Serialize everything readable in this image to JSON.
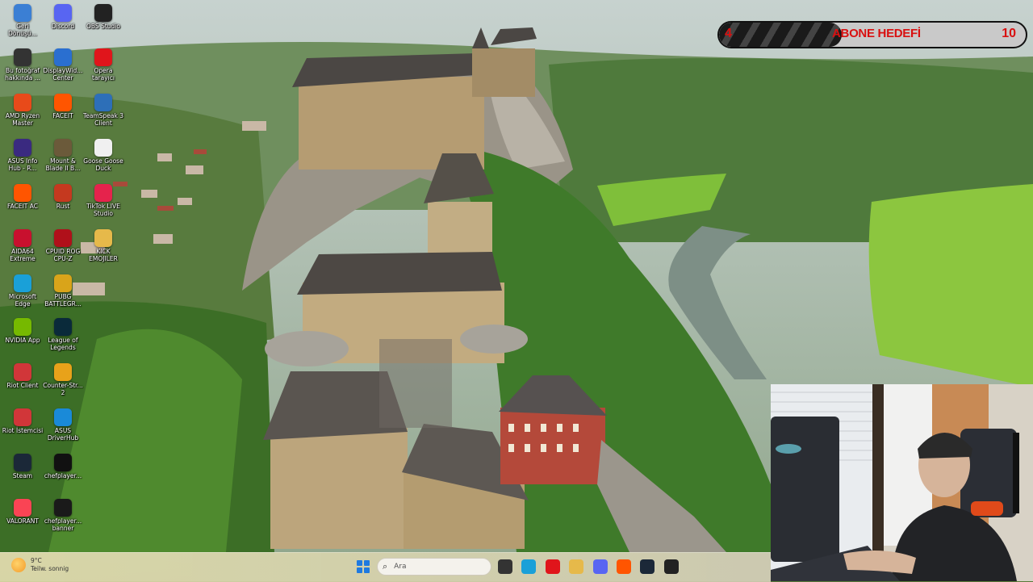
{
  "desktop": {
    "icons": [
      {
        "label": "Geri\nDönüşü...",
        "icon": "recycle-bin-icon",
        "color": "#3b7fd4"
      },
      {
        "label": "Discord",
        "icon": "discord-icon",
        "color": "#5865f2"
      },
      {
        "label": "OBS Studio",
        "icon": "obs-icon",
        "color": "#222222"
      },
      {
        "label": "Bu fotoğraf\nhakkında ...",
        "icon": "info-icon",
        "color": "#333333"
      },
      {
        "label": "DisplayWid...\nCenter",
        "icon": "display-icon",
        "color": "#2a6fd0"
      },
      {
        "label": "Opera\ntarayıcı",
        "icon": "opera-icon",
        "color": "#e0151b"
      },
      {
        "label": "AMD Ryzen\nMaster",
        "icon": "amd-icon",
        "color": "#e84a1a"
      },
      {
        "label": "FACEIT",
        "icon": "faceit-icon",
        "color": "#ff5500"
      },
      {
        "label": "TeamSpeak 3\nClient",
        "icon": "teamspeak-icon",
        "color": "#2d6fb8"
      },
      {
        "label": "ASUS Info\nHub - R...",
        "icon": "asus-icon",
        "color": "#3a2a80"
      },
      {
        "label": "Mount &\nBlade II B...",
        "icon": "mount-blade-icon",
        "color": "#6b5a3a"
      },
      {
        "label": "Goose Goose\nDuck",
        "icon": "goose-icon",
        "color": "#f0f0f0"
      },
      {
        "label": "FACEIT AC",
        "icon": "faceit-ac-icon",
        "color": "#ff5500"
      },
      {
        "label": "Rust",
        "icon": "rust-icon",
        "color": "#c5391f"
      },
      {
        "label": "TikTok LIVE\nStudio",
        "icon": "tiktok-icon",
        "color": "#e5234c"
      },
      {
        "label": "AIDA64\nExtreme",
        "icon": "aida64-icon",
        "color": "#c8102e"
      },
      {
        "label": "CPUID ROG\nCPU-Z",
        "icon": "cpuz-icon",
        "color": "#b0101a"
      },
      {
        "label": "KICK\nEMOJILER",
        "icon": "folder-icon",
        "color": "#e6b94a"
      },
      {
        "label": "Microsoft\nEdge",
        "icon": "edge-icon",
        "color": "#1aa0d8"
      },
      {
        "label": "PUBG\nBATTLEGR...",
        "icon": "pubg-icon",
        "color": "#d9a41a"
      },
      {
        "label": "NVIDIA App",
        "icon": "nvidia-icon",
        "color": "#76b900"
      },
      {
        "label": "League of\nLegends",
        "icon": "lol-icon",
        "color": "#0a2a3a"
      },
      {
        "label": "Riot Client",
        "icon": "riot-icon",
        "color": "#d13639"
      },
      {
        "label": "Counter-Str...\n2",
        "icon": "cs2-icon",
        "color": "#e8a21a"
      },
      {
        "label": "Riot İstemcisi",
        "icon": "riot-client-icon",
        "color": "#d13639"
      },
      {
        "label": "ASUS\nDriverHub",
        "icon": "asus-driverhub-icon",
        "color": "#1a8ad8"
      },
      {
        "label": "Steam",
        "icon": "steam-icon",
        "color": "#1b2838"
      },
      {
        "label": "chefplayer...",
        "icon": "chefplayer-icon",
        "color": "#111111"
      },
      {
        "label": "VALORANT",
        "icon": "valorant-icon",
        "color": "#fa4454"
      },
      {
        "label": "chefplayer...\nbanner",
        "icon": "chefplayer-banner-icon",
        "color": "#1a1a1a"
      }
    ]
  },
  "goal": {
    "current": "4",
    "title": "ABONE HEDEFİ",
    "target": "10",
    "progress": 0.4,
    "text_color": "#d91010"
  },
  "taskbar": {
    "weather_temp": "9°C",
    "weather_desc": "Teilw. sonnig",
    "search_placeholder": "Ara",
    "apps": [
      {
        "icon": "file-explorer-icon",
        "color": "#333333"
      },
      {
        "icon": "edge-icon",
        "color": "#1aa0d8"
      },
      {
        "icon": "opera-icon",
        "color": "#e0151b"
      },
      {
        "icon": "folder-icon",
        "color": "#e6b94a"
      },
      {
        "icon": "discord-icon",
        "color": "#5865f2"
      },
      {
        "icon": "faceit-icon",
        "color": "#ff5500"
      },
      {
        "icon": "steam-icon",
        "color": "#1b2838"
      },
      {
        "icon": "obs-icon",
        "color": "#222222"
      }
    ]
  }
}
